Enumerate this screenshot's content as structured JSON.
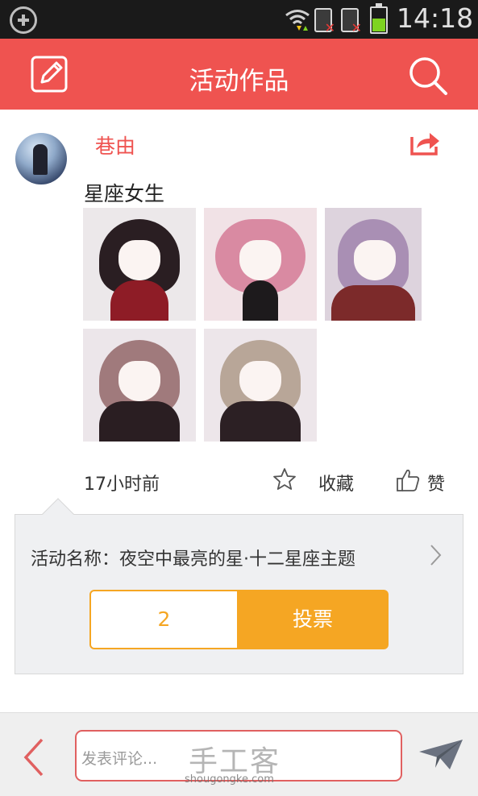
{
  "status_bar": {
    "time": "14:18",
    "icons": [
      "add-circle-icon",
      "wifi-icon",
      "sim-no-signal-icon",
      "sim-no-signal-icon",
      "battery-icon"
    ],
    "battery_level": 0.55
  },
  "header": {
    "title": "活动作品",
    "left_icon": "edit-icon",
    "right_icon": "search-icon",
    "background": "#ef5350"
  },
  "post": {
    "author": "巷由",
    "title": "星座女生",
    "time": "17小时前",
    "favorite_label": "收藏",
    "like_label": "赞",
    "share_icon": "share-icon",
    "images": [
      "image-1",
      "image-2",
      "image-3",
      "image-4",
      "image-5"
    ]
  },
  "activity": {
    "name": "活动名称：夜空中最亮的星·十二星座主题",
    "vote_count": "2",
    "vote_button": "投票",
    "accent": "#f5a623"
  },
  "comment_bar": {
    "placeholder": "发表评论...",
    "back_icon": "back-chevron-icon",
    "send_icon": "send-icon"
  },
  "watermark": {
    "logo": "手工客",
    "url": "shougongke.com"
  }
}
